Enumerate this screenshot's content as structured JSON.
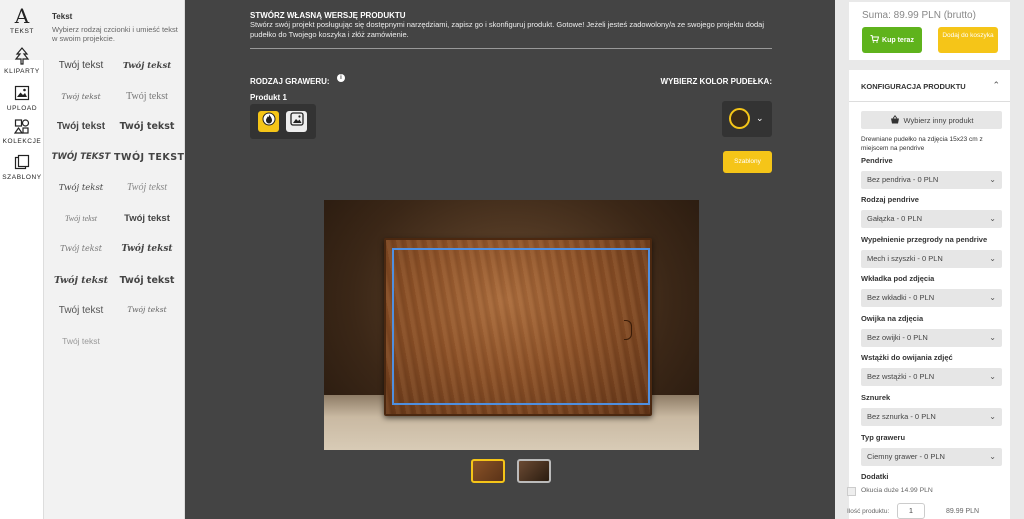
{
  "rail": [
    {
      "label": "TEKST",
      "icon": "text-icon"
    },
    {
      "label": "KLIPARTY",
      "icon": "tree-icon"
    },
    {
      "label": "UPLOAD",
      "icon": "image-upload-icon"
    },
    {
      "label": "KOLEKCJE",
      "icon": "collections-icon"
    },
    {
      "label": "SZABLONY",
      "icon": "templates-icon"
    }
  ],
  "text_panel": {
    "title": "Tekst",
    "description": "Wybierz rodzaj czcionki i umieść tekst w swoim projekcie.",
    "sample_text": "Twój tekst",
    "sample_text_caps": "TWÓJ TEKST"
  },
  "center": {
    "title": "STWÓRZ WŁASNĄ WERSJĘ PRODUKTU",
    "intro": "Stwórz swój projekt posługując się dostępnymi narzędziami, zapisz go i skonfiguruj produkt. Gotowe! Jeżeli jesteś zadowolony/a ze swojego projektu dodaj pudełko do Twojego koszyka i złóż zamówienie.",
    "engraving_label": "RODZAJ GRAWERU:",
    "info_symbol": "i",
    "product_label": "Produkt 1",
    "color_label": "WYBIERZ KOLOR PUDEŁKA:",
    "templates_button": "Szablony"
  },
  "right": {
    "sum": "Suma: 89.99 PLN (brutto)",
    "buy_now": "Kup teraz",
    "add_to_cart": "Dodaj do koszyka",
    "config_title": "KONFIGURACJA PRODUKTU",
    "choose_other": "Wybierz inny produkt",
    "product_desc": "Drewniane pudełko na zdjęcia 15x23 cm z miejscem na pendrive",
    "fields": [
      {
        "label": "Pendrive",
        "value": "Bez pendriva - 0 PLN"
      },
      {
        "label": "Rodzaj pendrive",
        "value": "Gałązka - 0 PLN"
      },
      {
        "label": "Wypełnienie przegrody na pendrive",
        "value": "Mech i szyszki - 0 PLN"
      },
      {
        "label": "Wkładka pod zdjęcia",
        "value": "Bez wkładki - 0 PLN"
      },
      {
        "label": "Owijka na zdjęcia",
        "value": "Bez owijki - 0 PLN"
      },
      {
        "label": "Wstążki do owijania zdjęć",
        "value": "Bez wstążki - 0 PLN"
      },
      {
        "label": "Sznurek",
        "value": "Bez sznurka - 0 PLN"
      },
      {
        "label": "Typ graweru",
        "value": "Ciemny grawer - 0 PLN"
      }
    ],
    "extras_label": "Dodatki",
    "extra_option": "Okucia duże 14.99 PLN",
    "qty_label": "Ilość produktu:",
    "qty_value": "1",
    "qty_price": "89.99 PLN"
  }
}
